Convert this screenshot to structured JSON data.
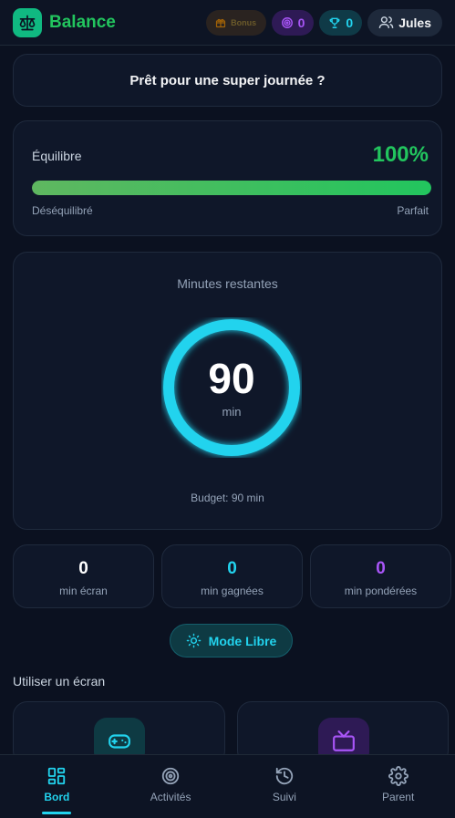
{
  "header": {
    "app_title": "Balance",
    "bonus_label": "Bonus",
    "target_count": "0",
    "trophy_count": "0",
    "user_name": "Jules"
  },
  "greeting": "Prêt pour une super journée ?",
  "balance": {
    "label": "Équilibre",
    "percent_text": "100%",
    "fill_fraction": 1.0,
    "low_label": "Déséquilibré",
    "high_label": "Parfait",
    "accent": "#22c55e"
  },
  "timer": {
    "title": "Minutes restantes",
    "value": "90",
    "unit": "min",
    "budget_text": "Budget: 90 min",
    "ring_color": "#22d3ee"
  },
  "stats": [
    {
      "value": "0",
      "label": "min écran",
      "color": "#ffffff"
    },
    {
      "value": "0",
      "label": "min gagnées",
      "color": "#22d3ee"
    },
    {
      "value": "0",
      "label": "min pondérées",
      "color": "#a855f7"
    }
  ],
  "mode_button": {
    "label": "Mode Libre",
    "icon": "sun-icon"
  },
  "use_section": {
    "title": "Utiliser un écran",
    "cards": [
      {
        "icon": "gamepad-icon",
        "color": "#22d3ee"
      },
      {
        "icon": "tv-icon",
        "color": "#a855f7"
      }
    ]
  },
  "nav": {
    "items": [
      {
        "label": "Bord",
        "icon": "grid-icon",
        "active": true
      },
      {
        "label": "Activités",
        "icon": "target-icon",
        "active": false
      },
      {
        "label": "Suivi",
        "icon": "history-icon",
        "active": false
      },
      {
        "label": "Parent",
        "icon": "gear-icon",
        "active": false
      }
    ]
  }
}
